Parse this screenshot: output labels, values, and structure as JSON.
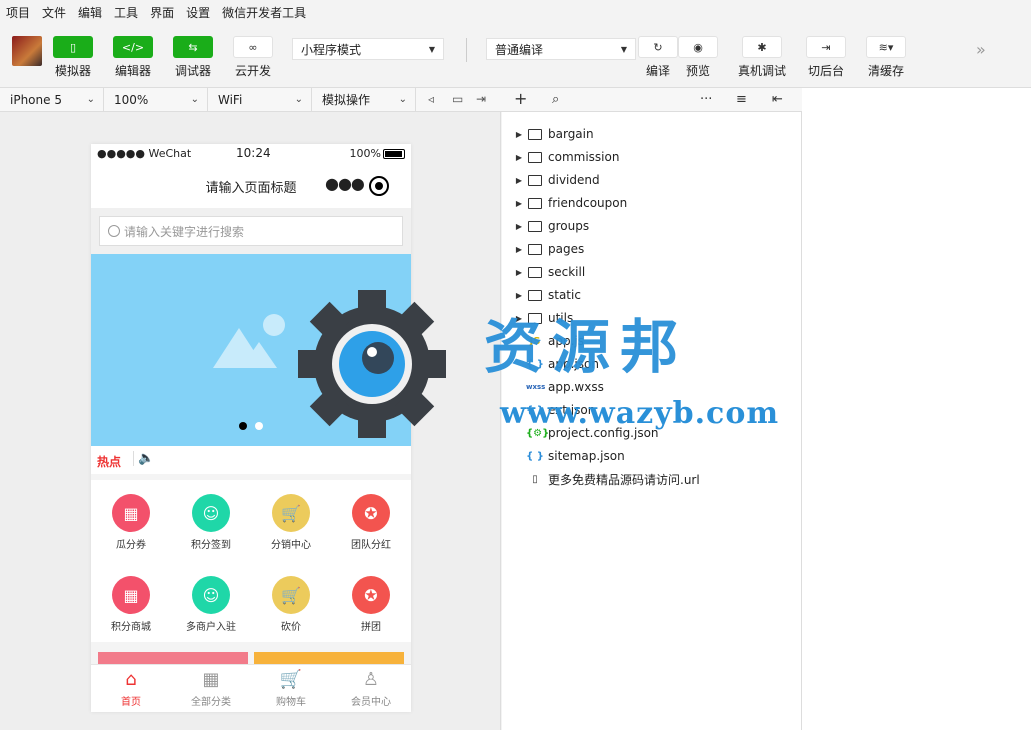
{
  "menu": [
    "项目",
    "文件",
    "编辑",
    "工具",
    "界面",
    "设置",
    "微信开发者工具"
  ],
  "toolbar": {
    "simulator_label": "模拟器",
    "editor_label": "编辑器",
    "debugger_label": "调试器",
    "cloud_label": "云开发",
    "mode_select": "小程序模式",
    "compile_select": "普通编译",
    "compile_label": "编译",
    "preview_label": "预览",
    "realdebug_label": "真机调试",
    "background_label": "切后台",
    "clearcache_label": "清缓存"
  },
  "subbar": {
    "device": "iPhone 5",
    "zoom": "100%",
    "network": "WiFi",
    "operation": "模拟操作"
  },
  "phone": {
    "status_left": "●●●●● WeChat",
    "status_time": "10:24",
    "status_battery": "100%",
    "nav_title": "请输入页面标题",
    "search_placeholder": "请输入关键字进行搜索",
    "hot_label": "热点",
    "grid": [
      {
        "label": "瓜分券",
        "color": "#f3516b",
        "icon": "grid-icon"
      },
      {
        "label": "积分签到",
        "color": "#1fd7a8",
        "icon": "user-icon"
      },
      {
        "label": "分销中心",
        "color": "#eccb5c",
        "icon": "cart-icon"
      },
      {
        "label": "团队分红",
        "color": "#f3544f",
        "icon": "award-icon"
      },
      {
        "label": "积分商城",
        "color": "#f3516b",
        "icon": "grid-icon"
      },
      {
        "label": "多商户入驻",
        "color": "#1fd7a8",
        "icon": "user-icon"
      },
      {
        "label": "砍价",
        "color": "#eccb5c",
        "icon": "cart-icon"
      },
      {
        "label": "拼团",
        "color": "#f3544f",
        "icon": "award-icon"
      }
    ],
    "tabs": [
      {
        "label": "首页",
        "icon": "home-icon",
        "active": true
      },
      {
        "label": "全部分类",
        "icon": "category-icon",
        "active": false
      },
      {
        "label": "购物车",
        "icon": "cart-icon",
        "active": false
      },
      {
        "label": "会员中心",
        "icon": "member-icon",
        "active": false
      }
    ]
  },
  "tree": {
    "folders": [
      "bargain",
      "commission",
      "dividend",
      "friendcoupon",
      "groups",
      "pages",
      "seckill",
      "static",
      "utils"
    ],
    "files": [
      {
        "name": "app.js",
        "badge": "JS",
        "kind": "js"
      },
      {
        "name": "app.json",
        "badge": "{ }",
        "kind": "json"
      },
      {
        "name": "app.wxss",
        "badge": "wxss",
        "kind": "wx"
      },
      {
        "name": "ext.json",
        "badge": "{ }",
        "kind": "json"
      },
      {
        "name": "project.config.json",
        "badge": "{⚙}",
        "kind": "cfg"
      },
      {
        "name": "sitemap.json",
        "badge": "{ }",
        "kind": "json"
      },
      {
        "name": "更多免费精品源码请访问.url",
        "badge": "▯",
        "kind": "doc"
      }
    ]
  },
  "watermark": {
    "title": "资源邦",
    "url": "www.wazyb.com"
  }
}
